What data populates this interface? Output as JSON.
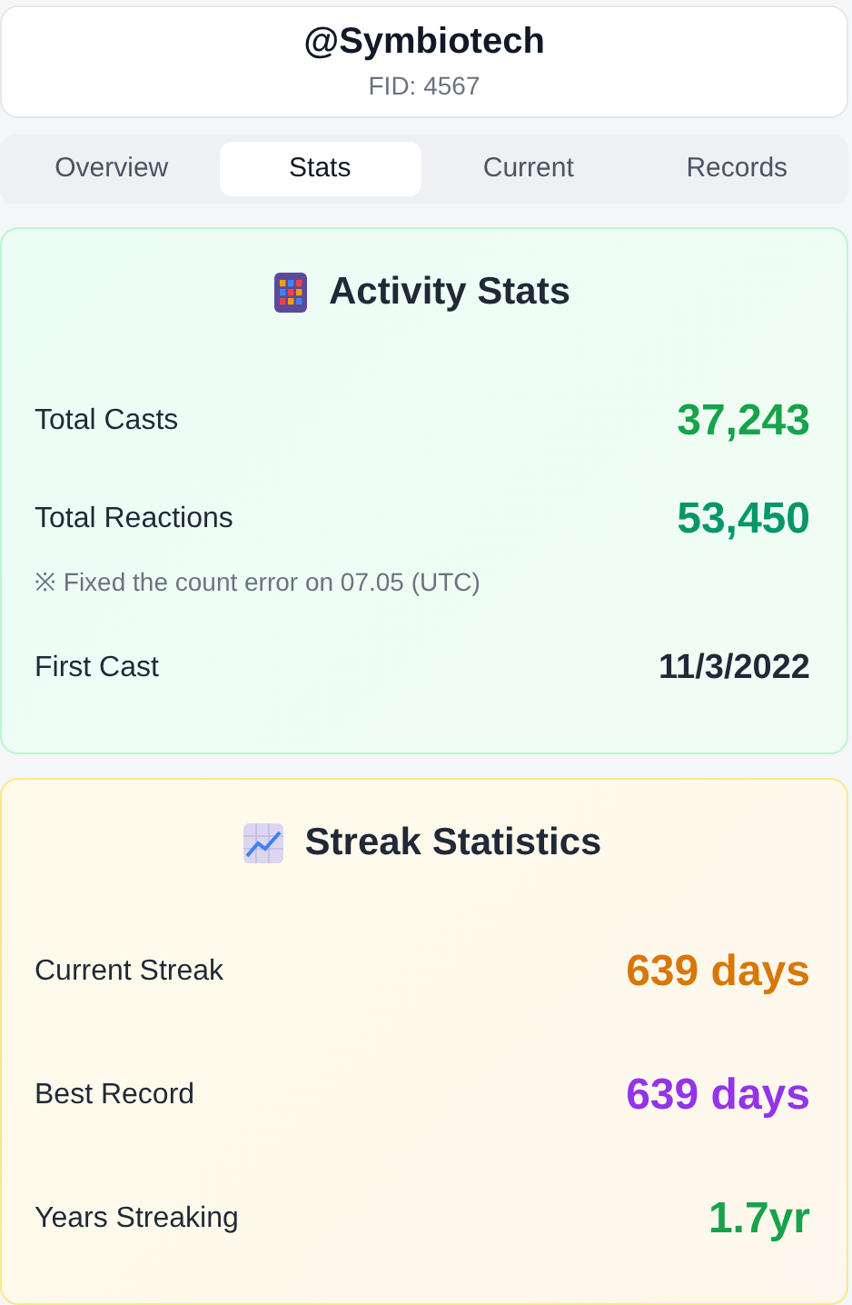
{
  "profile": {
    "username": "@Symbiotech",
    "fid": "FID: 4567"
  },
  "tabs": [
    {
      "label": "Overview",
      "selected": false
    },
    {
      "label": "Stats",
      "selected": true
    },
    {
      "label": "Current",
      "selected": false
    },
    {
      "label": "Records",
      "selected": false
    }
  ],
  "sections": [
    {
      "kind": "activity",
      "title": "Activity Stats",
      "rows": [
        {
          "label": "Total Casts",
          "value": "37,243",
          "color": "#16a34a"
        },
        {
          "label": "Total Reactions",
          "value": "53,450",
          "color": "#059669",
          "note": "※ Fixed the count error on 07.05 (UTC)"
        },
        {
          "label": "First Cast",
          "value": "11/3/2022",
          "color": "#1f2937"
        }
      ]
    },
    {
      "kind": "streak",
      "title": "Streak Statistics",
      "rows": [
        {
          "label": "Current Streak",
          "value": "639 days",
          "color": "#d97706"
        },
        {
          "label": "Best Record",
          "value": "639 days",
          "color": "#9333ea"
        },
        {
          "label": "Years Streaking",
          "value": "1.7yr",
          "color": "#16a34a"
        }
      ]
    }
  ]
}
